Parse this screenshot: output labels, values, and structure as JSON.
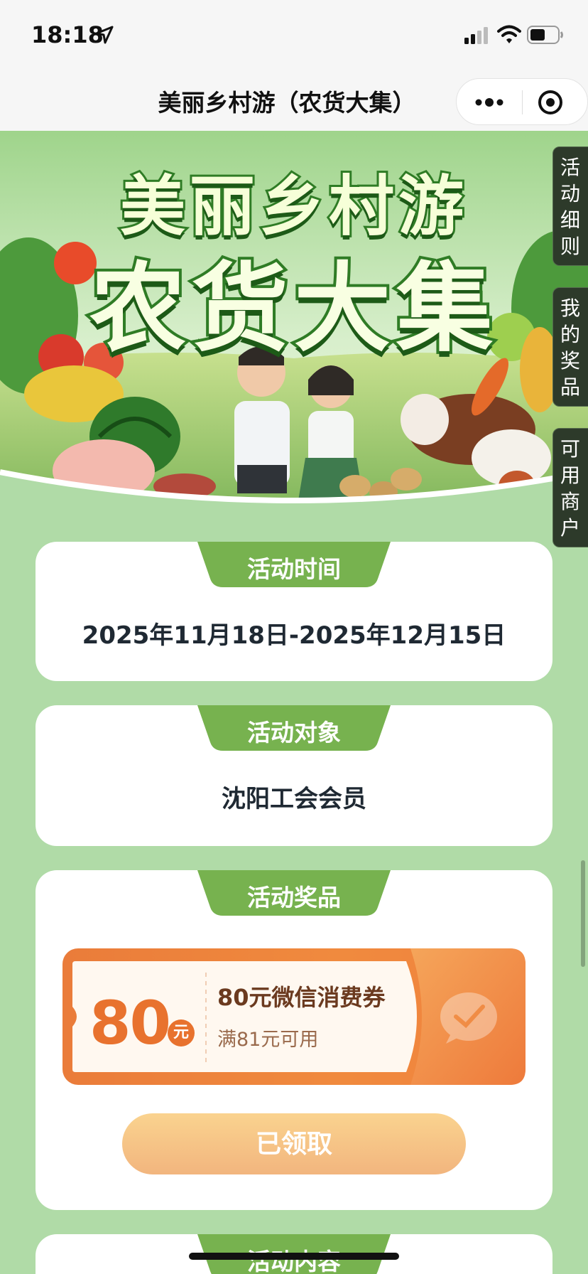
{
  "status_bar": {
    "time": "18:18",
    "icons": [
      "location-arrow-icon",
      "signal-icon",
      "wifi-icon",
      "battery-icon"
    ]
  },
  "nav": {
    "title": "美丽乡村游（农货大集）",
    "icons": [
      "more-icon",
      "target-icon"
    ]
  },
  "banner": {
    "title_line1": "美丽乡村游",
    "title_line2": "农货大集"
  },
  "side_tabs": [
    {
      "label": "活动细则"
    },
    {
      "label": "我的奖品"
    },
    {
      "label": "可用商户"
    }
  ],
  "sections": {
    "time": {
      "header": "活动时间",
      "value": "2025年11月18日-2025年12月15日"
    },
    "target": {
      "header": "活动对象",
      "value": "沈阳工会会员"
    },
    "prize": {
      "header": "活动奖品",
      "coupon": {
        "amount": "80",
        "unit": "元",
        "title": "80元微信消费券",
        "condition": "满81元可用"
      },
      "claim_label": "已领取"
    },
    "content": {
      "header": "活动内容"
    }
  },
  "colors": {
    "background": "#b0dba7",
    "header_green": "#77b24f",
    "coupon_orange": "#e8722e",
    "claim_button": "#f5c688"
  }
}
